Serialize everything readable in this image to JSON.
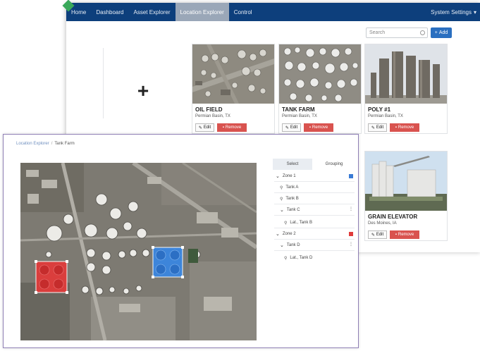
{
  "nav": {
    "items": [
      "Home",
      "Dashboard",
      "Asset Explorer",
      "Location Explorer",
      "Control"
    ],
    "active_index": 3,
    "system_settings": "System Settings"
  },
  "toolbar": {
    "search_placeholder": "Search",
    "add_label": "Add"
  },
  "cards": [
    {
      "title": "OIL FIELD",
      "sub": "Permian Basin, TX",
      "edit": "Edit",
      "remove": "Remove"
    },
    {
      "title": "TANK FARM",
      "sub": "Permian Basin, TX",
      "edit": "Edit",
      "remove": "Remove"
    },
    {
      "title": "POLY #1",
      "sub": "Permian Basin, TX",
      "edit": "Edit",
      "remove": "Remove"
    },
    {
      "title": "GRAIN ELEVATOR",
      "sub": "Des Moines, IA",
      "edit": "Edit",
      "remove": "Remove"
    }
  ],
  "detail": {
    "breadcrumb_root": "Location Explorer",
    "breadcrumb_current": "Tank Farm",
    "tabs": [
      "Select",
      "Grouping"
    ],
    "tree": {
      "zone1": "Zone 1",
      "tankA": "Tank A",
      "tankB": "Tank B",
      "tankC": "Tank C",
      "loc1": "Lat., Tank B",
      "zone2": "Zone 2",
      "tankD": "Tank D",
      "loc2": "Lat., Tank D"
    },
    "zone_colors": {
      "zone1": "#3a7bd5",
      "zone2": "#e03b3b"
    }
  },
  "icons": {
    "add": "plus-icon",
    "edit": "edit-icon",
    "remove": "trash-icon",
    "location": "pin-icon"
  }
}
